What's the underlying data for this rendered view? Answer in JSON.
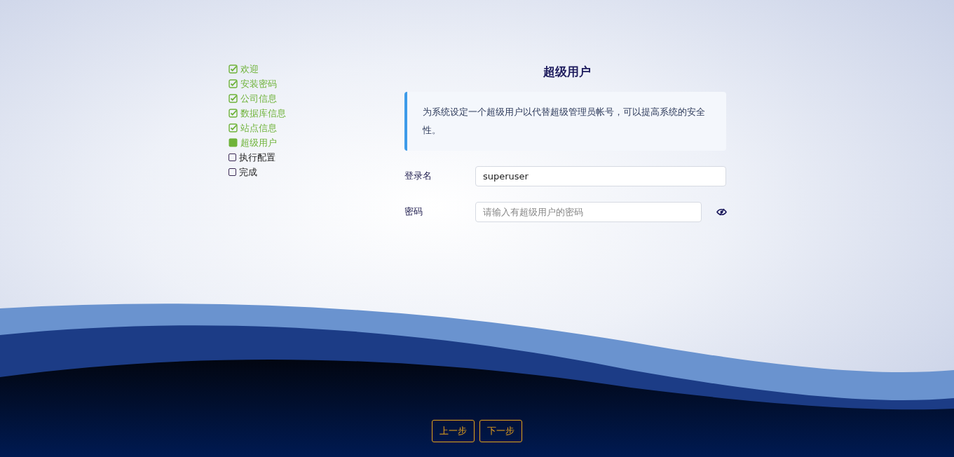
{
  "steps": [
    {
      "label": "欢迎",
      "checked": true,
      "selected": false
    },
    {
      "label": "安装密码",
      "checked": true,
      "selected": false
    },
    {
      "label": "公司信息",
      "checked": true,
      "selected": false
    },
    {
      "label": "数据库信息",
      "checked": true,
      "selected": false
    },
    {
      "label": "站点信息",
      "checked": true,
      "selected": false
    },
    {
      "label": "超级用户",
      "checked": false,
      "selected": true
    },
    {
      "label": "执行配置",
      "checked": false,
      "selected": false
    },
    {
      "label": "完成",
      "checked": false,
      "selected": false
    }
  ],
  "title": "超级用户",
  "notice": "为系统设定一个超级用户以代替超级管理员帐号，可以提高系统的安全性。",
  "fields": [
    {
      "label": "登录名",
      "value": "superuser",
      "reveal": false
    },
    {
      "label": "密码",
      "placeholder": "请输入有超级用户的密码",
      "reveal": true
    }
  ],
  "buttons": [
    "上一步",
    "下一步"
  ]
}
